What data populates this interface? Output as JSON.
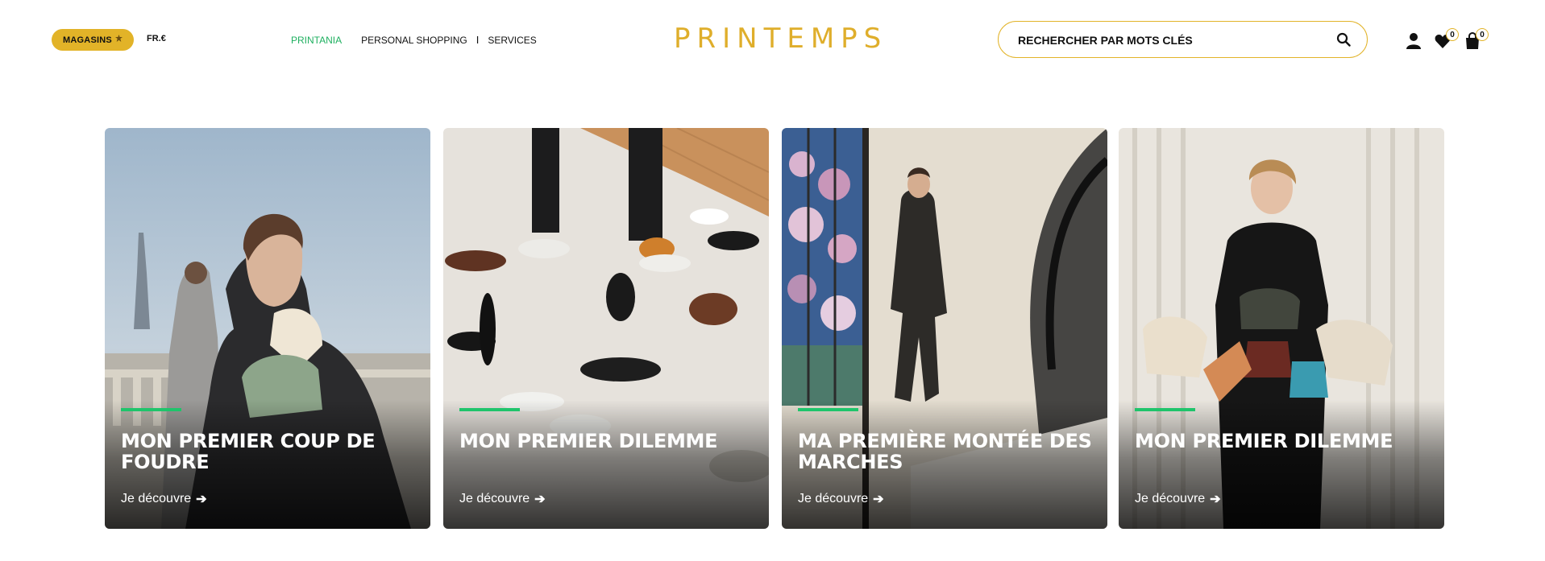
{
  "header": {
    "stores_label": "MAGASINS",
    "lang_label": "FR.€",
    "nav": [
      {
        "label": "PRINTANIA",
        "active": true
      },
      {
        "label": "PERSONAL SHOPPING"
      },
      {
        "label": "SERVICES"
      }
    ],
    "nav_separator": "I",
    "logo": "PRINTEMPS",
    "search_placeholder": "RECHERCHER PAR MOTS CLÉS",
    "wishlist_count": "0",
    "cart_count": "0"
  },
  "cards": [
    {
      "title": "MON PREMIER COUP DE FOUDRE",
      "cta": "Je découvre"
    },
    {
      "title": "MON PREMIER DILEMME",
      "cta": "Je découvre"
    },
    {
      "title": "MA PREMIÈRE MONTÉE DES MARCHES",
      "cta": "Je découvre"
    },
    {
      "title": "MON PREMIER DILEMME",
      "cta": "Je découvre"
    }
  ],
  "colors": {
    "brand_gold": "#dfae2b",
    "accent_green": "#1fc46b",
    "nav_active": "#1fb060"
  },
  "icons": [
    "search-icon",
    "user-icon",
    "heart-icon",
    "bag-icon",
    "arrow-right-icon",
    "pin-icon"
  ]
}
